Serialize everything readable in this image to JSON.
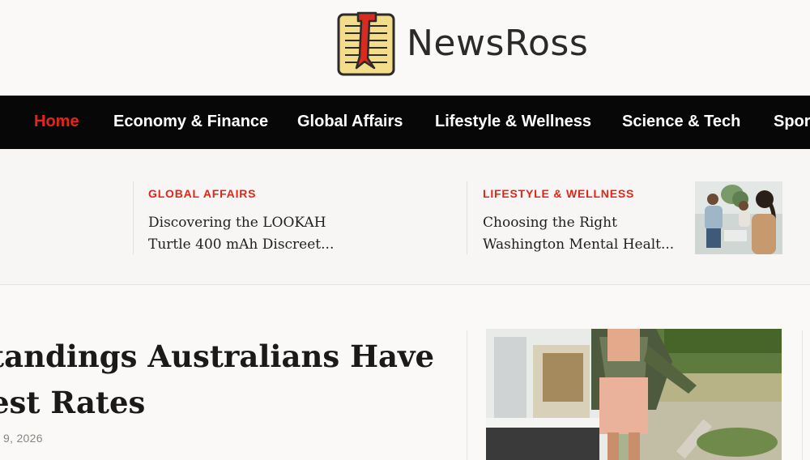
{
  "header": {
    "logo_text": "NewsRoss",
    "logo_icon": "notepad-bookmark-icon"
  },
  "nav": {
    "items": [
      {
        "label": "Home",
        "active": true
      },
      {
        "label": "Economy & Finance",
        "active": false
      },
      {
        "label": "Global Affairs",
        "active": false
      },
      {
        "label": "Lifestyle & Wellness",
        "active": false
      },
      {
        "label": "Science & Tech",
        "active": false
      },
      {
        "label": "Sports",
        "active": false
      }
    ]
  },
  "ticker": {
    "items": [
      {
        "category": "GLOBAL AFFAIRS",
        "title_line1": "Discovering the LOOKAH",
        "title_line2": "Turtle 400 mAh Discreet..."
      },
      {
        "category": "LIFESTYLE & WELLNESS",
        "title_line1": "Choosing the Right",
        "title_line2": "Washington Mental Healt..."
      }
    ]
  },
  "featured": {
    "headline_line1": "tandings Australians Have",
    "headline_line2": "est Rates",
    "date": "9, 2026"
  },
  "colors": {
    "accent_red": "#e32417",
    "nav_background": "#070707",
    "page_background": "#fbf9f7"
  }
}
